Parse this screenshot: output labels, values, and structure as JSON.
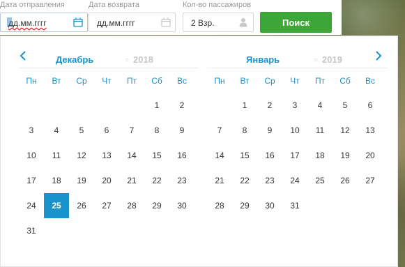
{
  "search": {
    "departure_label": "Дата отправления",
    "departure_placeholder": "дд.мм.гггг",
    "return_label": "Дата возврата",
    "return_placeholder": "дд.мм.гггг",
    "passengers_label": "Кол-во пассажиров",
    "passengers_value": "2 Взр.",
    "search_button": "Поиск"
  },
  "colors": {
    "accent": "#1a92cc",
    "search_button": "#3da638",
    "muted_year": "#c8c8c8"
  },
  "calendar": {
    "prev_icon": "chevron-left-icon",
    "next_icon": "chevron-right-icon",
    "left": {
      "month": "Декабрь",
      "year": "2018",
      "weekdays": [
        "Пн",
        "Вт",
        "Ср",
        "Чт",
        "Пт",
        "Сб",
        "Вс"
      ],
      "weeks": [
        [
          "",
          "",
          "",
          "",
          "",
          "1",
          "2"
        ],
        [
          "3",
          "4",
          "5",
          "6",
          "7",
          "8",
          "9"
        ],
        [
          "10",
          "11",
          "12",
          "13",
          "14",
          "15",
          "16"
        ],
        [
          "17",
          "18",
          "19",
          "20",
          "21",
          "22",
          "23"
        ],
        [
          "24",
          "25",
          "26",
          "27",
          "28",
          "29",
          "30"
        ],
        [
          "31",
          "",
          "",
          "",
          "",
          "",
          ""
        ]
      ],
      "selected": "25"
    },
    "right": {
      "month": "Январь",
      "year": "2019",
      "weekdays": [
        "Пн",
        "Вт",
        "Ср",
        "Чт",
        "Пт",
        "Сб",
        "Вс"
      ],
      "weeks": [
        [
          "",
          "1",
          "2",
          "3",
          "4",
          "5",
          "6"
        ],
        [
          "7",
          "8",
          "9",
          "10",
          "11",
          "12",
          "13"
        ],
        [
          "14",
          "15",
          "16",
          "17",
          "18",
          "19",
          "20"
        ],
        [
          "21",
          "22",
          "23",
          "24",
          "25",
          "26",
          "27"
        ],
        [
          "28",
          "29",
          "30",
          "31",
          "",
          "",
          ""
        ]
      ],
      "selected": ""
    }
  }
}
